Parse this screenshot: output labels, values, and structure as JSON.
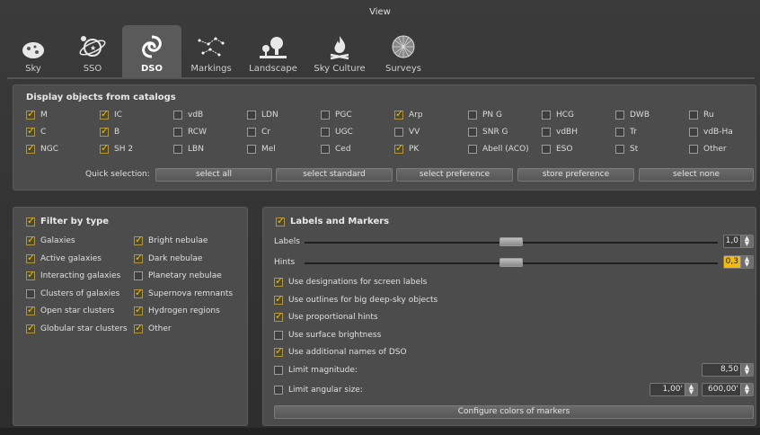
{
  "window": {
    "title": "View"
  },
  "tabs": [
    {
      "label": "Sky",
      "icon": "sky-icon",
      "active": false
    },
    {
      "label": "SSO",
      "icon": "sso-icon",
      "active": false
    },
    {
      "label": "DSO",
      "icon": "galaxy-icon",
      "active": true
    },
    {
      "label": "Markings",
      "icon": "markings-icon",
      "active": false
    },
    {
      "label": "Landscape",
      "icon": "landscape-icon",
      "active": false
    },
    {
      "label": "Sky Culture",
      "icon": "campfire-icon",
      "active": false
    },
    {
      "label": "Surveys",
      "icon": "sphere-icon",
      "active": false
    }
  ],
  "catalogs": {
    "title": "Display objects from catalogs",
    "items": [
      {
        "label": "M",
        "checked": true
      },
      {
        "label": "IC",
        "checked": true
      },
      {
        "label": "vdB",
        "checked": false
      },
      {
        "label": "LDN",
        "checked": false
      },
      {
        "label": "PGC",
        "checked": false
      },
      {
        "label": "Arp",
        "checked": true
      },
      {
        "label": "PN G",
        "checked": false
      },
      {
        "label": "HCG",
        "checked": false
      },
      {
        "label": "DWB",
        "checked": false
      },
      {
        "label": "Ru",
        "checked": false
      },
      {
        "label": "C",
        "checked": true
      },
      {
        "label": "B",
        "checked": true
      },
      {
        "label": "RCW",
        "checked": false
      },
      {
        "label": "Cr",
        "checked": false
      },
      {
        "label": "UGC",
        "checked": false
      },
      {
        "label": "VV",
        "checked": false
      },
      {
        "label": "SNR G",
        "checked": false
      },
      {
        "label": "vdBH",
        "checked": false
      },
      {
        "label": "Tr",
        "checked": false
      },
      {
        "label": "vdB-Ha",
        "checked": false
      },
      {
        "label": "NGC",
        "checked": true
      },
      {
        "label": "SH 2",
        "checked": true
      },
      {
        "label": "LBN",
        "checked": false
      },
      {
        "label": "Mel",
        "checked": false
      },
      {
        "label": "Ced",
        "checked": false
      },
      {
        "label": "PK",
        "checked": true
      },
      {
        "label": "Abell (ACO)",
        "checked": false
      },
      {
        "label": "ESO",
        "checked": false
      },
      {
        "label": "St",
        "checked": false
      },
      {
        "label": "Other",
        "checked": false
      }
    ],
    "quick_selection_label": "Quick selection:",
    "buttons": [
      "select all",
      "select standard",
      "select preference",
      "store preference",
      "select none"
    ]
  },
  "filter": {
    "title": "Filter by type",
    "checked": true,
    "left": [
      {
        "label": "Galaxies",
        "checked": true
      },
      {
        "label": "Active galaxies",
        "checked": true
      },
      {
        "label": "Interacting galaxies",
        "checked": true
      },
      {
        "label": "Clusters of galaxies",
        "checked": false
      },
      {
        "label": "Open star clusters",
        "checked": true
      },
      {
        "label": "Globular star clusters",
        "checked": true
      }
    ],
    "right": [
      {
        "label": "Bright nebulae",
        "checked": true
      },
      {
        "label": "Dark nebulae",
        "checked": true
      },
      {
        "label": "Planetary nebulae",
        "checked": false
      },
      {
        "label": "Supernova remnants",
        "checked": true
      },
      {
        "label": "Hydrogen regions",
        "checked": true
      },
      {
        "label": "Other",
        "checked": true
      }
    ]
  },
  "labels": {
    "title": "Labels and Markers",
    "checked": true,
    "labels_label": "Labels",
    "labels_value": "1,0",
    "labels_level": 0.5,
    "hints_label": "Hints",
    "hints_value": "0,3",
    "hints_level": 0.5,
    "options": [
      {
        "label": "Use designations for screen labels",
        "checked": true
      },
      {
        "label": "Use outlines for big deep-sky objects",
        "checked": true
      },
      {
        "label": "Use proportional hints",
        "checked": true
      },
      {
        "label": "Use surface brightness",
        "checked": false
      },
      {
        "label": "Use additional names of DSO",
        "checked": true
      }
    ],
    "limit_magnitude_label": "Limit magnitude:",
    "limit_magnitude_value": "8,50",
    "limit_angular_label": "Limit angular size:",
    "limit_angular_min": "1,00'",
    "limit_angular_max": "600,00'",
    "configure_button": "Configure colors of markers"
  }
}
